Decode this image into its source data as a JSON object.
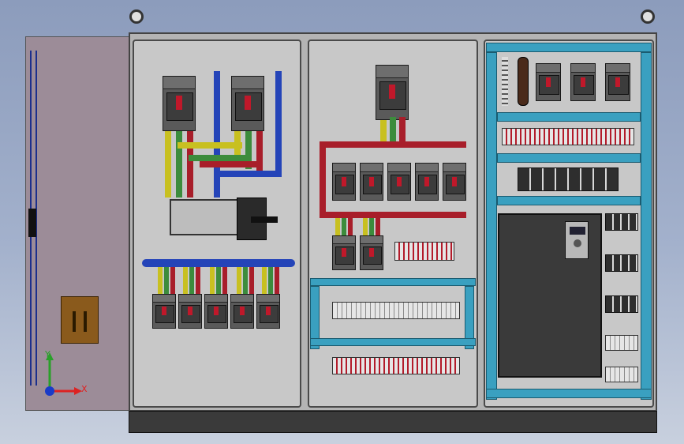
{
  "axes": {
    "x_label": "X",
    "y_label": "Y"
  },
  "colors": {
    "cabinet": "#b4b4b4",
    "busbar_red": "#a81e2a",
    "busbar_yellow": "#c8c020",
    "busbar_green": "#3c8c3c",
    "busbar_blue": "#2444b8",
    "din_rail": "#3aa0c0"
  },
  "icons": [
    "lifting-eye-icon",
    "circuit-breaker-icon",
    "frequency-inverter-icon",
    "terminal-block-icon",
    "axis-triad-icon"
  ]
}
